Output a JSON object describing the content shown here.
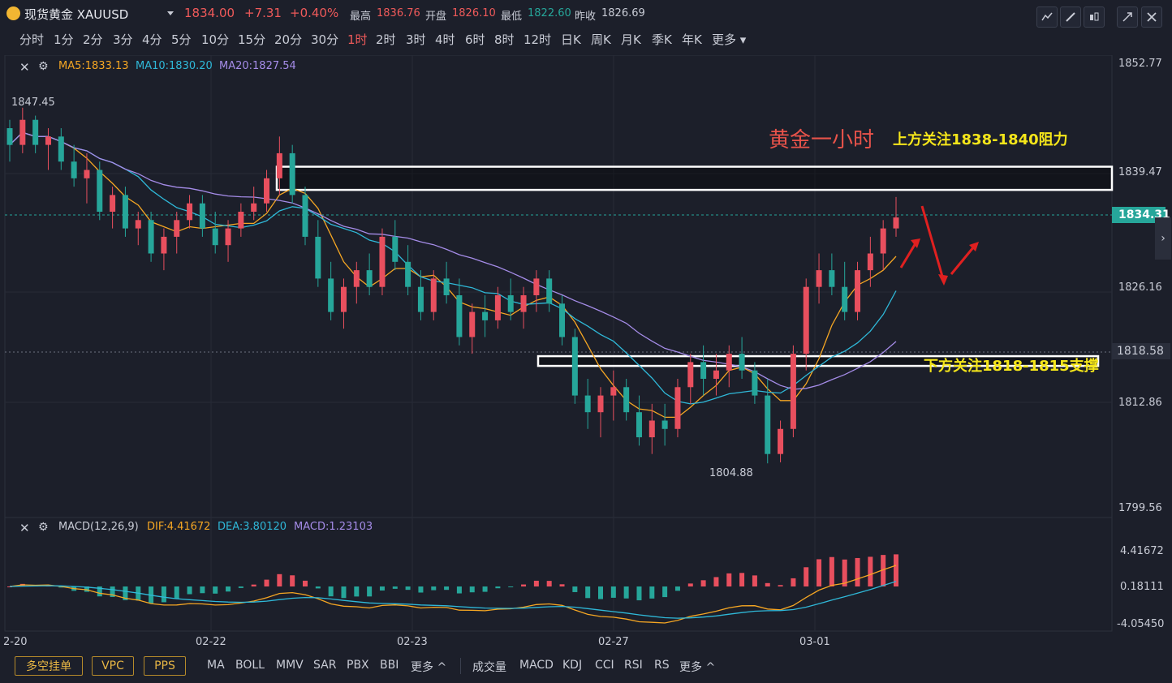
{
  "header": {
    "symbol": "现货黄金 XAUUSD",
    "price": "1834.00",
    "change": "+7.31",
    "change_pct": "+0.40%",
    "high_label": "最高",
    "high": "1836.76",
    "open_label": "开盘",
    "open": "1826.10",
    "low_label": "最低",
    "low": "1822.60",
    "prev_label": "昨收",
    "prev": "1826.69"
  },
  "timeframes": [
    "分时",
    "1分",
    "2分",
    "3分",
    "4分",
    "5分",
    "10分",
    "15分",
    "20分",
    "30分",
    "1时",
    "2时",
    "3时",
    "4时",
    "6时",
    "8时",
    "12时",
    "日K",
    "周K",
    "月K",
    "季K",
    "年K",
    "更多"
  ],
  "active_timeframe": "1时",
  "ma_legend": {
    "ma5": "MA5:1833.13",
    "ma10": "MA10:1830.20",
    "ma20": "MA20:1827.54"
  },
  "macd_legend": {
    "title": "MACD(12,26,9)",
    "dif": "DIF:4.41672",
    "dea": "DEA:3.80120",
    "macd": "MACD:1.23103"
  },
  "annotations": {
    "main_title": "黄金一小时",
    "upper": "上方关注1838-1840阻力",
    "lower": "下方关注1818-1815支撑",
    "high_mark": "1847.45",
    "low_mark": "1804.88"
  },
  "price_axis": [
    "1852.77",
    "1839.47",
    "1826.16",
    "1818.58",
    "1812.86",
    "1799.56"
  ],
  "current_price_tag": "1834.31",
  "macd_axis": [
    "4.41672",
    "0.18111",
    "-4.05450"
  ],
  "date_axis": [
    "2-20",
    "02-22",
    "02-23",
    "02-27",
    "03-01"
  ],
  "bottom": {
    "buttons": [
      "多空挂单",
      "VPC",
      "PPS"
    ],
    "main_indicators": [
      "MA",
      "BOLL",
      "MMV",
      "SAR",
      "PBX",
      "BBI",
      "更多 ^"
    ],
    "sub_indicators": [
      "成交量",
      "MACD",
      "KDJ",
      "CCI",
      "RSI",
      "RS",
      "更多 ^"
    ]
  },
  "colors": {
    "up": "#e84f5e",
    "down": "#26a69a",
    "ma5": "#f5a623",
    "ma10": "#2fb8d8",
    "ma20": "#a58ce8",
    "accent_red": "#f05a5a",
    "note_yellow": "#f5e61a",
    "title_red": "#e8534a"
  },
  "chart_data": {
    "type": "candlestick",
    "title": "现货黄金 XAUUSD 1时",
    "y_range": [
      1799.56,
      1852.77
    ],
    "resistance_zone": [
      1838,
      1840
    ],
    "support_zone": [
      1815,
      1818
    ],
    "candles": [
      [
        1845,
        1846,
        1841,
        1843
      ],
      [
        1843,
        1847.45,
        1842,
        1846
      ],
      [
        1846,
        1846.5,
        1842,
        1843
      ],
      [
        1843,
        1845,
        1840,
        1844
      ],
      [
        1844,
        1845,
        1840,
        1841
      ],
      [
        1841,
        1843,
        1838,
        1839
      ],
      [
        1839,
        1842,
        1836,
        1840
      ],
      [
        1840,
        1841,
        1834,
        1835
      ],
      [
        1835,
        1838,
        1833,
        1837
      ],
      [
        1837,
        1838,
        1832,
        1833
      ],
      [
        1833,
        1835,
        1831,
        1834
      ],
      [
        1834,
        1835,
        1829,
        1830
      ],
      [
        1830,
        1833,
        1828,
        1832
      ],
      [
        1832,
        1835,
        1830,
        1834
      ],
      [
        1834,
        1837,
        1833,
        1836
      ],
      [
        1836,
        1837,
        1832,
        1833
      ],
      [
        1833,
        1835,
        1830,
        1831
      ],
      [
        1831,
        1834,
        1829,
        1833
      ],
      [
        1833,
        1836,
        1832,
        1835
      ],
      [
        1835,
        1838,
        1834,
        1836
      ],
      [
        1836,
        1840,
        1835,
        1839
      ],
      [
        1839,
        1844,
        1837,
        1842
      ],
      [
        1842,
        1843,
        1836,
        1837
      ],
      [
        1837,
        1838,
        1831,
        1832
      ],
      [
        1832,
        1834,
        1826,
        1827
      ],
      [
        1827,
        1829,
        1822,
        1823
      ],
      [
        1823,
        1827,
        1821,
        1826
      ],
      [
        1826,
        1829,
        1824,
        1828
      ],
      [
        1828,
        1830,
        1825,
        1826
      ],
      [
        1826,
        1833,
        1825,
        1832
      ],
      [
        1832,
        1834,
        1828,
        1829
      ],
      [
        1829,
        1831,
        1825,
        1826
      ],
      [
        1826,
        1828,
        1822,
        1823
      ],
      [
        1823,
        1828,
        1822,
        1827
      ],
      [
        1827,
        1829,
        1824,
        1825
      ],
      [
        1825,
        1827,
        1819,
        1820
      ],
      [
        1820,
        1824,
        1818,
        1823
      ],
      [
        1823,
        1825,
        1820,
        1822
      ],
      [
        1822,
        1826,
        1821,
        1825
      ],
      [
        1825,
        1827,
        1822,
        1823
      ],
      [
        1823,
        1826,
        1821,
        1825
      ],
      [
        1825,
        1828,
        1823,
        1827
      ],
      [
        1827,
        1828,
        1823,
        1824
      ],
      [
        1824,
        1825,
        1819,
        1820
      ],
      [
        1820,
        1821,
        1812,
        1813
      ],
      [
        1813,
        1815,
        1809,
        1811
      ],
      [
        1811,
        1814,
        1808,
        1813
      ],
      [
        1813,
        1816,
        1810,
        1814
      ],
      [
        1814,
        1815,
        1810,
        1811
      ],
      [
        1811,
        1813,
        1807,
        1808
      ],
      [
        1808,
        1812,
        1806,
        1810
      ],
      [
        1810,
        1812,
        1807,
        1809
      ],
      [
        1809,
        1815,
        1808,
        1814
      ],
      [
        1814,
        1818,
        1812,
        1817
      ],
      [
        1817,
        1819,
        1813,
        1815
      ],
      [
        1815,
        1818,
        1813,
        1816
      ],
      [
        1816,
        1819,
        1814,
        1818
      ],
      [
        1818,
        1820,
        1815,
        1816
      ],
      [
        1816,
        1817,
        1812,
        1813
      ],
      [
        1813,
        1815,
        1804.88,
        1806
      ],
      [
        1806,
        1810,
        1805,
        1809
      ],
      [
        1809,
        1819,
        1808,
        1818
      ],
      [
        1818,
        1827,
        1816,
        1826
      ],
      [
        1826,
        1830,
        1824,
        1828
      ],
      [
        1828,
        1830,
        1825,
        1826
      ],
      [
        1826,
        1829,
        1822,
        1823
      ],
      [
        1823,
        1829,
        1822,
        1828
      ],
      [
        1828,
        1832,
        1826,
        1830
      ],
      [
        1830,
        1834,
        1828,
        1833
      ],
      [
        1833,
        1836.76,
        1832,
        1834.31
      ]
    ]
  }
}
